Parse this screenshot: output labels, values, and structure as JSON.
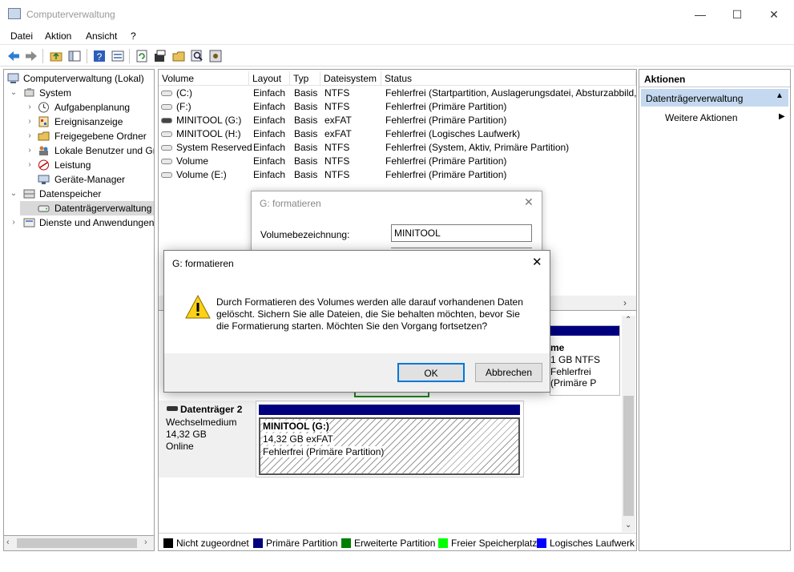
{
  "window": {
    "title": "Computerverwaltung",
    "minimize": "—",
    "maximize": "☐",
    "close": "✕"
  },
  "menu": [
    "Datei",
    "Aktion",
    "Ansicht",
    "?"
  ],
  "tree": {
    "root": "Computerverwaltung (Lokal)",
    "system": "System",
    "items": [
      "Aufgabenplanung",
      "Ereignisanzeige",
      "Freigegebene Ordner",
      "Lokale Benutzer und Gruppen",
      "Leistung",
      "Geräte-Manager"
    ],
    "storage": "Datenspeicher",
    "disk_mgmt": "Datenträgerverwaltung",
    "services": "Dienste und Anwendungen"
  },
  "volumes": {
    "columns": [
      "Volume",
      "Layout",
      "Typ",
      "Dateisystem",
      "Status"
    ],
    "rows": [
      [
        "(C:)",
        "Einfach",
        "Basis",
        "NTFS",
        "Fehlerfrei (Startpartition, Auslagerungsdatei, Absturzabbild, Primäre Partition)"
      ],
      [
        "(F:)",
        "Einfach",
        "Basis",
        "NTFS",
        "Fehlerfrei (Primäre Partition)"
      ],
      [
        "MINITOOL (G:)",
        "Einfach",
        "Basis",
        "exFAT",
        "Fehlerfrei (Primäre Partition)"
      ],
      [
        "MINITOOL (H:)",
        "Einfach",
        "Basis",
        "exFAT",
        "Fehlerfrei (Logisches Laufwerk)"
      ],
      [
        "System Reserved",
        "Einfach",
        "Basis",
        "NTFS",
        "Fehlerfrei (System, Aktiv, Primäre Partition)"
      ],
      [
        "Volume",
        "Einfach",
        "Basis",
        "NTFS",
        "Fehlerfrei (Primäre Partition)"
      ],
      [
        "Volume (E:)",
        "Einfach",
        "Basis",
        "NTFS",
        "Fehlerfrei (Primäre Partition)"
      ]
    ]
  },
  "upper_partition": {
    "name": "me",
    "size": "1 GB NTFS",
    "status": "Fehlerfrei (Primäre P"
  },
  "disk2": {
    "name": "Datenträger 2",
    "type": "Wechselmedium",
    "size": "14,32 GB",
    "state": "Online",
    "partition": {
      "name": "MINITOOL  (G:)",
      "size": "14,32 GB exFAT",
      "status": "Fehlerfrei (Primäre Partition)"
    }
  },
  "legend": [
    {
      "label": "Nicht zugeordnet",
      "color": "#000000"
    },
    {
      "label": "Primäre Partition",
      "color": "#00007f"
    },
    {
      "label": "Erweiterte Partition",
      "color": "#007f00"
    },
    {
      "label": "Freier Speicherplatz",
      "color": "#00ff00"
    },
    {
      "label": "Logisches Laufwerk",
      "color": "#0000ff"
    }
  ],
  "actions": {
    "header": "Aktionen",
    "section": "Datenträgerverwaltung",
    "more": "Weitere Aktionen"
  },
  "format_dialog": {
    "title": "G: formatieren",
    "label": "Volumebezeichnung:",
    "value": "MINITOOL"
  },
  "confirm_dialog": {
    "title": "G: formatieren",
    "message1": "Durch Formatieren des Volumes werden alle darauf vorhandenen Daten",
    "message2": "gelöscht. Sichern Sie alle Dateien, die Sie behalten möchten, bevor Sie",
    "message3": "die Formatierung starten. Möchten Sie den Vorgang fortsetzen?",
    "ok": "OK",
    "cancel": "Abbrechen"
  }
}
